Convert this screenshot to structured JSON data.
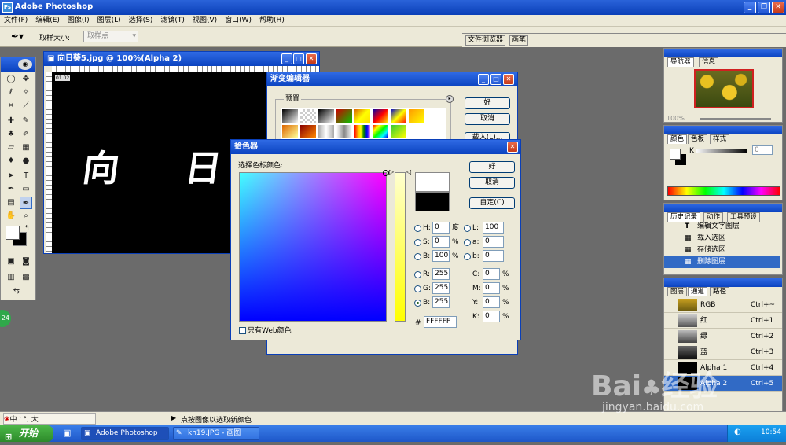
{
  "app": {
    "title": "Adobe Photoshop"
  },
  "menu": [
    "文件(F)",
    "编辑(E)",
    "图像(I)",
    "图层(L)",
    "选择(S)",
    "滤镜(T)",
    "视图(V)",
    "窗口(W)",
    "帮助(H)"
  ],
  "options": {
    "sample_size_label": "取样大小:",
    "sample_size_value": "取样点",
    "palette_well": [
      "文件浏览器",
      "画笔"
    ]
  },
  "document": {
    "title": "向日葵5.jpg @ 100%(Alpha 2)",
    "text": "向 日",
    "badge": "01 02"
  },
  "gradient_editor": {
    "title": "渐变编辑器",
    "presets_label": "预置",
    "ok": "好",
    "cancel": "取消",
    "load": "载入(L)..."
  },
  "color_picker": {
    "title": "拾色器",
    "select_label": "选择色标颜色:",
    "ok": "好",
    "cancel": "取消",
    "custom": "自定(C)",
    "web_only": "只有Web颜色",
    "hsb": [
      {
        "label": "H:",
        "value": "0",
        "unit": "度"
      },
      {
        "label": "S:",
        "value": "0",
        "unit": "%"
      },
      {
        "label": "B:",
        "value": "100",
        "unit": "%"
      }
    ],
    "rgb": [
      {
        "label": "R:",
        "value": "255"
      },
      {
        "label": "G:",
        "value": "255"
      },
      {
        "label": "B:",
        "value": "255"
      }
    ],
    "lab": [
      {
        "label": "L:",
        "value": "100"
      },
      {
        "label": "a:",
        "value": "0"
      },
      {
        "label": "b:",
        "value": "0"
      }
    ],
    "cmyk": [
      {
        "label": "C:",
        "value": "0",
        "unit": "%"
      },
      {
        "label": "M:",
        "value": "0",
        "unit": "%"
      },
      {
        "label": "Y:",
        "value": "0",
        "unit": "%"
      },
      {
        "label": "K:",
        "value": "0",
        "unit": "%"
      }
    ],
    "hex_label": "#",
    "hex": "FFFFFF"
  },
  "navigator": {
    "tabs": [
      "导航器",
      "信息"
    ],
    "zoom": "100%"
  },
  "color_panel": {
    "tabs": [
      "颜色",
      "色板",
      "样式"
    ],
    "k_label": "K",
    "k_value": "0"
  },
  "history_panel": {
    "tabs": [
      "历史记录",
      "动作",
      "工具预设"
    ],
    "items": [
      "编辑文字图层",
      "载入选区",
      "存储选区",
      "删除图层"
    ]
  },
  "channels_panel": {
    "tabs": [
      "图层",
      "通道",
      "路径"
    ],
    "channels": [
      {
        "name": "RGB",
        "shortcut": "Ctrl+~"
      },
      {
        "name": "红",
        "shortcut": "Ctrl+1"
      },
      {
        "name": "绿",
        "shortcut": "Ctrl+2"
      },
      {
        "name": "蓝",
        "shortcut": "Ctrl+3"
      },
      {
        "name": "Alpha 1",
        "shortcut": "Ctrl+4"
      },
      {
        "name": "Alpha 2",
        "shortcut": "Ctrl+5"
      }
    ]
  },
  "status": {
    "message": "点按图像以选取新颜色",
    "ime": "中 ⁾ °, 大"
  },
  "taskbar": {
    "start": "开始",
    "items": [
      "Adobe Photoshop",
      "kh19.JPG - 画图"
    ],
    "clock": "10:54"
  },
  "watermark": {
    "site": "jingyan.baidu.com"
  }
}
